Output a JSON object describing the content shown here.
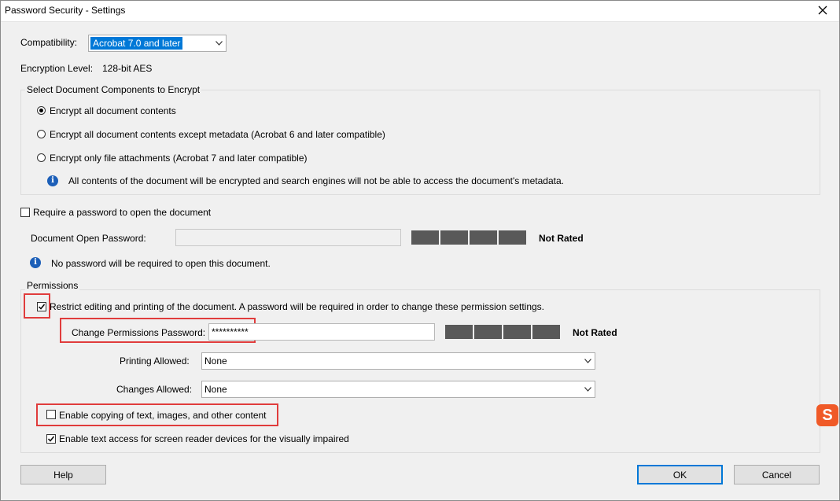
{
  "window": {
    "title": "Password Security - Settings"
  },
  "compatibility": {
    "label": "Compatibility:",
    "value": "Acrobat 7.0 and later"
  },
  "encryption": {
    "label": "Encryption  Level:",
    "value": "128-bit AES"
  },
  "components": {
    "title": "Select Document Components to Encrypt",
    "options": [
      {
        "label": "Encrypt all document contents",
        "selected": true
      },
      {
        "label": "Encrypt all document contents except metadata (Acrobat 6 and later compatible)",
        "selected": false
      },
      {
        "label": "Encrypt only file attachments (Acrobat 7 and later compatible)",
        "selected": false
      }
    ],
    "info": "All contents of the document will be encrypted and search engines will not be able to access the document's metadata."
  },
  "open_password": {
    "checkbox_label": "Require a password to open the document",
    "checked": false,
    "field_label": "Document Open Password:",
    "rating": "Not Rated",
    "info": "No password will be required to open this document."
  },
  "permissions": {
    "title": "Permissions",
    "restrict_label": "Restrict editing and printing of the document. A password will be required in order to change these permission settings.",
    "restrict_checked": true,
    "password_label": "Change Permissions Password:",
    "password_value": "**********",
    "rating": "Not Rated",
    "printing_label": "Printing Allowed:",
    "printing_value": "None",
    "changes_label": "Changes Allowed:",
    "changes_value": "None",
    "copy_label": "Enable copying of text, images, and other content",
    "copy_checked": false,
    "screenreader_label": "Enable text access for screen reader devices for the visually impaired",
    "screenreader_checked": true
  },
  "buttons": {
    "help": "Help",
    "ok": "OK",
    "cancel": "Cancel"
  },
  "colors": {
    "highlight": "#e03c3c",
    "accent": "#0078d7",
    "meter": "#595959"
  },
  "tray_logo": "S"
}
